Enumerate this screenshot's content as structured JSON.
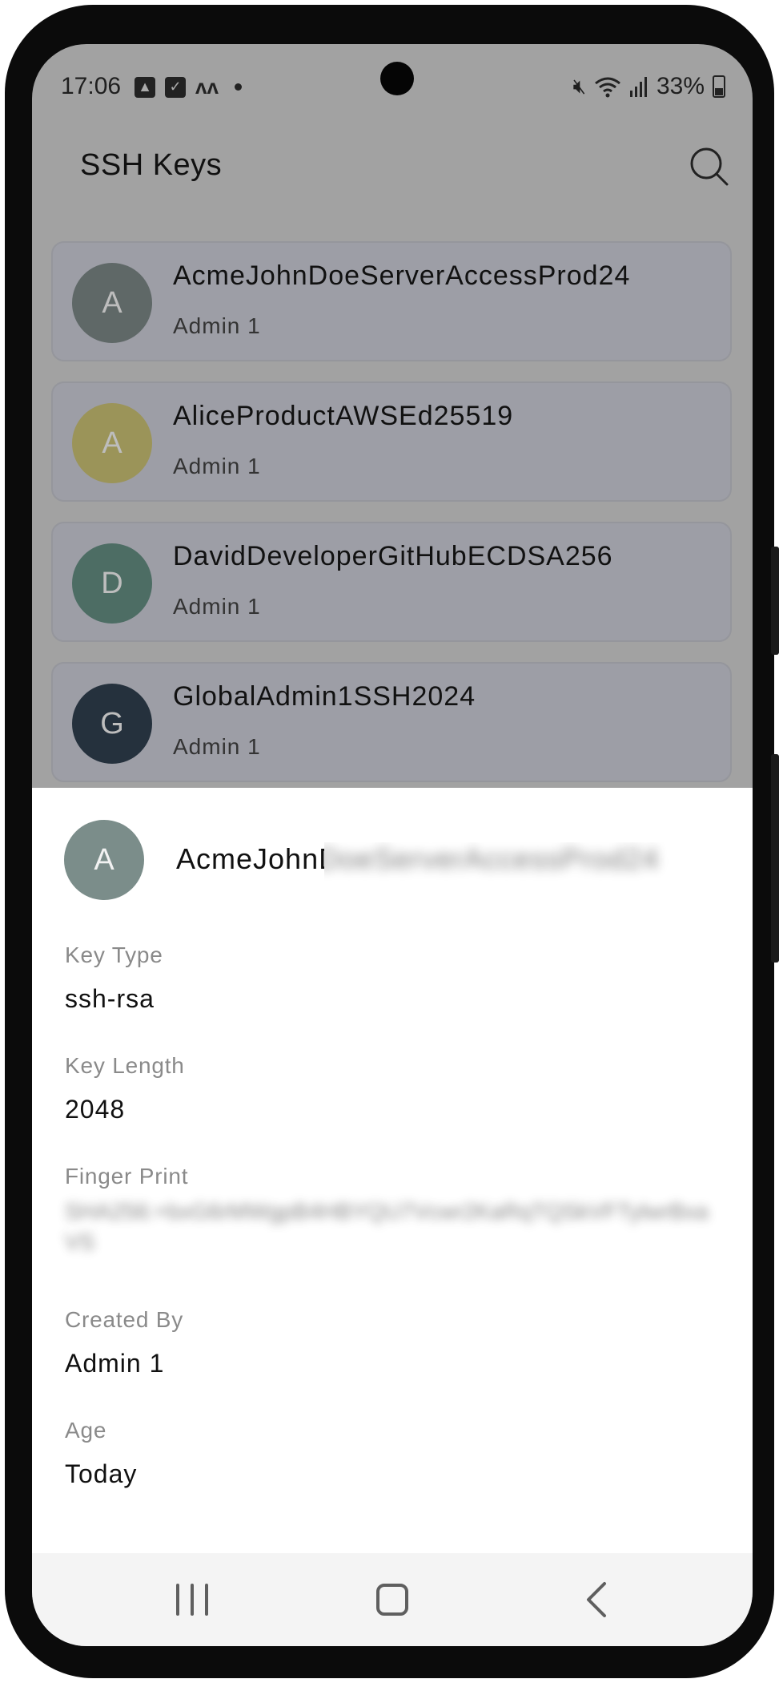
{
  "status_bar": {
    "time": "17:06",
    "battery": "33%"
  },
  "app_bar": {
    "title": "SSH Keys"
  },
  "keys": [
    {
      "initial": "A",
      "name": "AcmeJohnDoeServerAccessProd24",
      "owner": "Admin 1",
      "avatar_color": "#5f6867"
    },
    {
      "initial": "A",
      "name": "AliceProductAWSEd25519",
      "owner": "Admin 1",
      "avatar_color": "#9b9459"
    },
    {
      "initial": "D",
      "name": "DavidDeveloperGitHubECDSA256",
      "owner": "Admin 1",
      "avatar_color": "#4d6d64"
    },
    {
      "initial": "G",
      "name": "GlobalAdmin1SSH2024",
      "owner": "Admin 1",
      "avatar_color": "#25313d"
    }
  ],
  "detail": {
    "initial": "A",
    "title": "AcmeJohnDoeServerAccessProd24",
    "key_type_label": "Key Type",
    "key_type": "ssh-rsa",
    "key_length_label": "Key Length",
    "key_length": "2048",
    "fingerprint_label": "Finger Print",
    "fingerprint": "SHA256:+bxG6rMWgpB4HBYQU7Vcwr2KaRqTQSkVFTylwrBxaVS",
    "created_by_label": "Created By",
    "created_by": "Admin 1",
    "age_label": "Age",
    "age": "Today"
  }
}
